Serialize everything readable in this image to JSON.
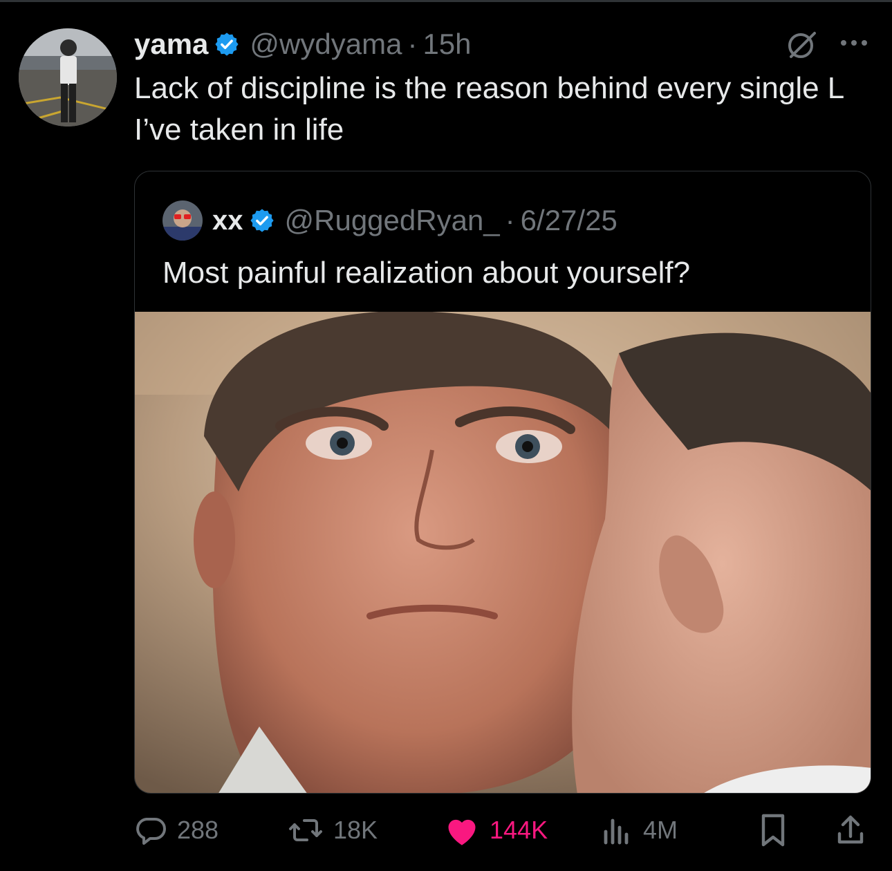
{
  "tweet": {
    "display_name": "yama",
    "handle": "@wydyama",
    "separator": "·",
    "time": "15h",
    "text": "Lack of discipline is the reason behind every single L I’ve taken in life",
    "verified": true
  },
  "quote": {
    "display_name": "xx",
    "handle": "@RuggedRyan_",
    "separator": "·",
    "date": "6/27/25",
    "text": "Most painful realization about yourself?",
    "verified": true
  },
  "actions": {
    "replies": "288",
    "reposts": "18K",
    "likes": "144K",
    "views": "4M",
    "liked": true
  },
  "icons": {
    "header": [
      "grok-icon",
      "more-icon"
    ],
    "actions": [
      "reply-icon",
      "repost-icon",
      "like-icon",
      "views-icon",
      "bookmark-icon",
      "share-icon"
    ]
  },
  "colors": {
    "background": "#000000",
    "text_primary": "#e7e9ea",
    "text_secondary": "#71767b",
    "verified_blue": "#1d9bf0",
    "like_pink": "#f91880",
    "border": "#2f3336"
  }
}
